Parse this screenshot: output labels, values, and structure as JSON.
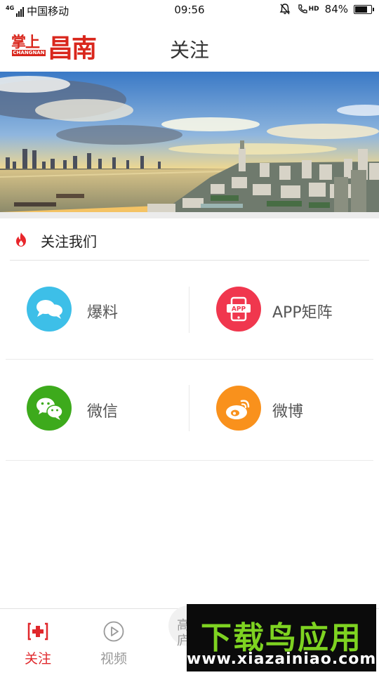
{
  "status_bar": {
    "network": "4G",
    "carrier": "中国移动",
    "time": "09:56",
    "hd_badge": "HD",
    "battery_percent": "84%",
    "battery_level": 0.84
  },
  "header": {
    "logo_small": "掌上",
    "logo_big": "昌南",
    "logo_en": "CHANGNAN",
    "title": "关注"
  },
  "section": {
    "title": "关注我们"
  },
  "grid": {
    "items": [
      {
        "label": "爆料",
        "icon": "chat-bubbles-icon",
        "color": "#3dbfe8"
      },
      {
        "label": "APP矩阵",
        "icon": "app-matrix-icon",
        "color": "#f0374e"
      },
      {
        "label": "微信",
        "icon": "wechat-icon",
        "color": "#3daa1c"
      },
      {
        "label": "微博",
        "icon": "weibo-icon",
        "color": "#f9911c"
      }
    ]
  },
  "tabbar": {
    "tabs": [
      {
        "label": "关注",
        "icon": "follow-icon",
        "active": true
      },
      {
        "label": "视频",
        "icon": "play-icon",
        "active": false
      },
      {
        "label": "高庐",
        "icon": "",
        "active": false
      }
    ],
    "active_color": "#e0282c",
    "inactive_color": "#999999"
  },
  "watermark": {
    "title": "下载鸟应用",
    "url": "www.xiazainiao.com"
  }
}
